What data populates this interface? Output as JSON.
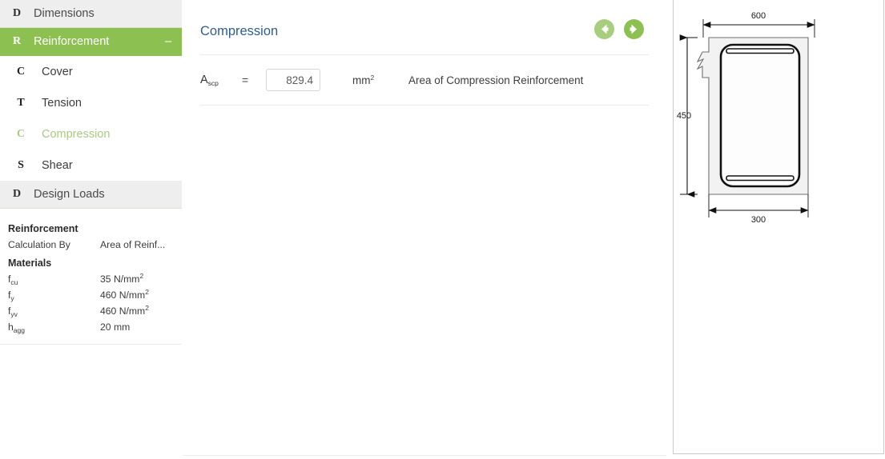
{
  "sidebar": {
    "groups": [
      {
        "icon": "D",
        "label": "Dimensions",
        "active": false,
        "collapse": ""
      },
      {
        "icon": "R",
        "label": "Reinforcement",
        "active": true,
        "collapse": "–"
      },
      {
        "icon": "D",
        "label": "Design Loads",
        "active": false,
        "collapse": ""
      }
    ],
    "subitems": [
      {
        "icon": "C",
        "label": "Cover",
        "current": false
      },
      {
        "icon": "T",
        "label": "Tension",
        "current": false
      },
      {
        "icon": "C",
        "label": "Compression",
        "current": true
      },
      {
        "icon": "S",
        "label": "Shear",
        "current": false
      }
    ]
  },
  "summary": {
    "section_title": "Reinforcement",
    "calculation_by_label": "Calculation By",
    "calculation_by_value": "Area of Reinf...",
    "materials_title": "Materials",
    "materials": [
      {
        "symbol": "f",
        "sub": "cu",
        "value": "35 N/mm",
        "sup": "2"
      },
      {
        "symbol": "f",
        "sub": "y",
        "value": "460 N/mm",
        "sup": "2"
      },
      {
        "symbol": "f",
        "sub": "yv",
        "value": "460 N/mm",
        "sup": "2"
      },
      {
        "symbol": "h",
        "sub": "agg",
        "value": "20 mm",
        "sup": ""
      }
    ]
  },
  "main": {
    "title": "Compression",
    "back_icon": "arrow-left-circle-icon",
    "forward_icon": "arrow-right-circle-icon",
    "field": {
      "symbol": "A",
      "symbol_sub": "scp",
      "equals": "=",
      "value": "829.4",
      "placeholder": "",
      "unit": "mm",
      "unit_sup": "2",
      "description": "Area of Compression Reinforcement"
    }
  },
  "drawing": {
    "name": "beam-cross-section",
    "dim_top": "600",
    "dim_left": "450",
    "dim_bottom": "300"
  },
  "colors": {
    "accent_green": "#8cc152",
    "accent_green_light": "#a8cd7e",
    "title_blue": "#2e5d8c",
    "muted_green": "#a9ca83"
  }
}
